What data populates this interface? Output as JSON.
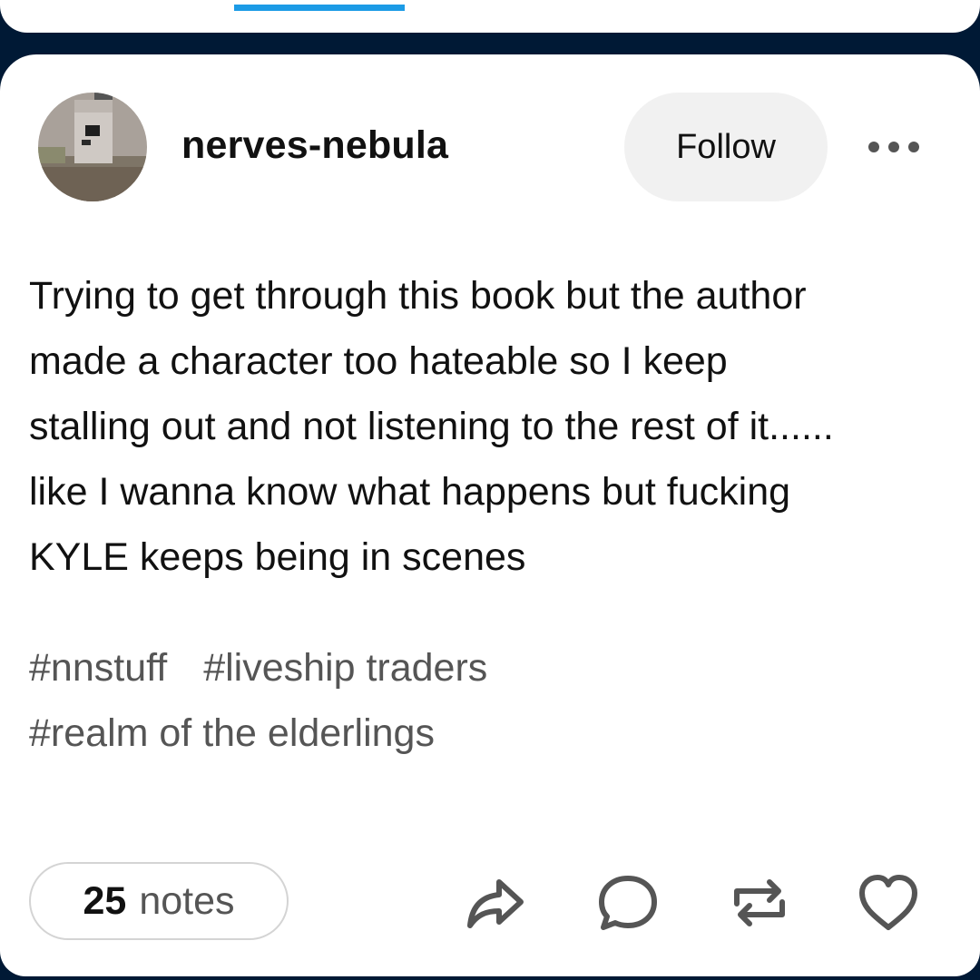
{
  "post": {
    "username": "nerves-nebula",
    "follow_label": "Follow",
    "more_icon": "more-horizontal-icon",
    "body_lines": [
      "Trying to get through this book but the author",
      "made a character too hateable so I keep",
      "stalling out and not listening to the rest of it......",
      "like I wanna know what happens but fucking",
      "KYLE keeps being in scenes"
    ],
    "tags": [
      "#nnstuff",
      "#liveship traders",
      "#realm of the elderlings"
    ],
    "notes_count": "25",
    "notes_label": "notes",
    "actions": {
      "share_icon": "share-icon",
      "reply_icon": "comment-icon",
      "reblog_icon": "reblog-icon",
      "like_icon": "heart-icon"
    }
  },
  "colors": {
    "background": "#001935",
    "card": "#ffffff",
    "accent_tab": "#1c9be6",
    "follow_bg": "#f1f1f1",
    "text_primary": "#111111",
    "text_secondary": "#555555"
  }
}
